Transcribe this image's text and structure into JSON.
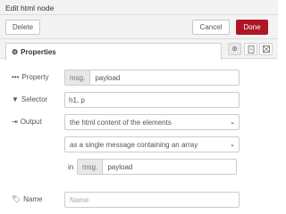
{
  "header": {
    "title": "Edit html node"
  },
  "buttons": {
    "delete": "Delete",
    "cancel": "Cancel",
    "done": "Done"
  },
  "tabs": {
    "properties": "Properties"
  },
  "form": {
    "property": {
      "label": "Property",
      "type": "msg.",
      "value": "payload"
    },
    "selector": {
      "label": "Selector",
      "value": "h1, p"
    },
    "output": {
      "label": "Output",
      "select1": "the html content of the elements",
      "select2": "as a single message containing an array"
    },
    "in": {
      "label": "in",
      "type": "msg.",
      "value": "payload"
    },
    "name": {
      "label": "Name",
      "placeholder": "Name"
    }
  },
  "colors": {
    "done_button": "#ad1625",
    "header_bg": "#f3f3f3"
  },
  "icons": [
    "gear-icon",
    "ellipsis-icon",
    "tag-icon",
    "sign-in-icon",
    "tag-name-icon",
    "document-icon",
    "grid-icon"
  ]
}
